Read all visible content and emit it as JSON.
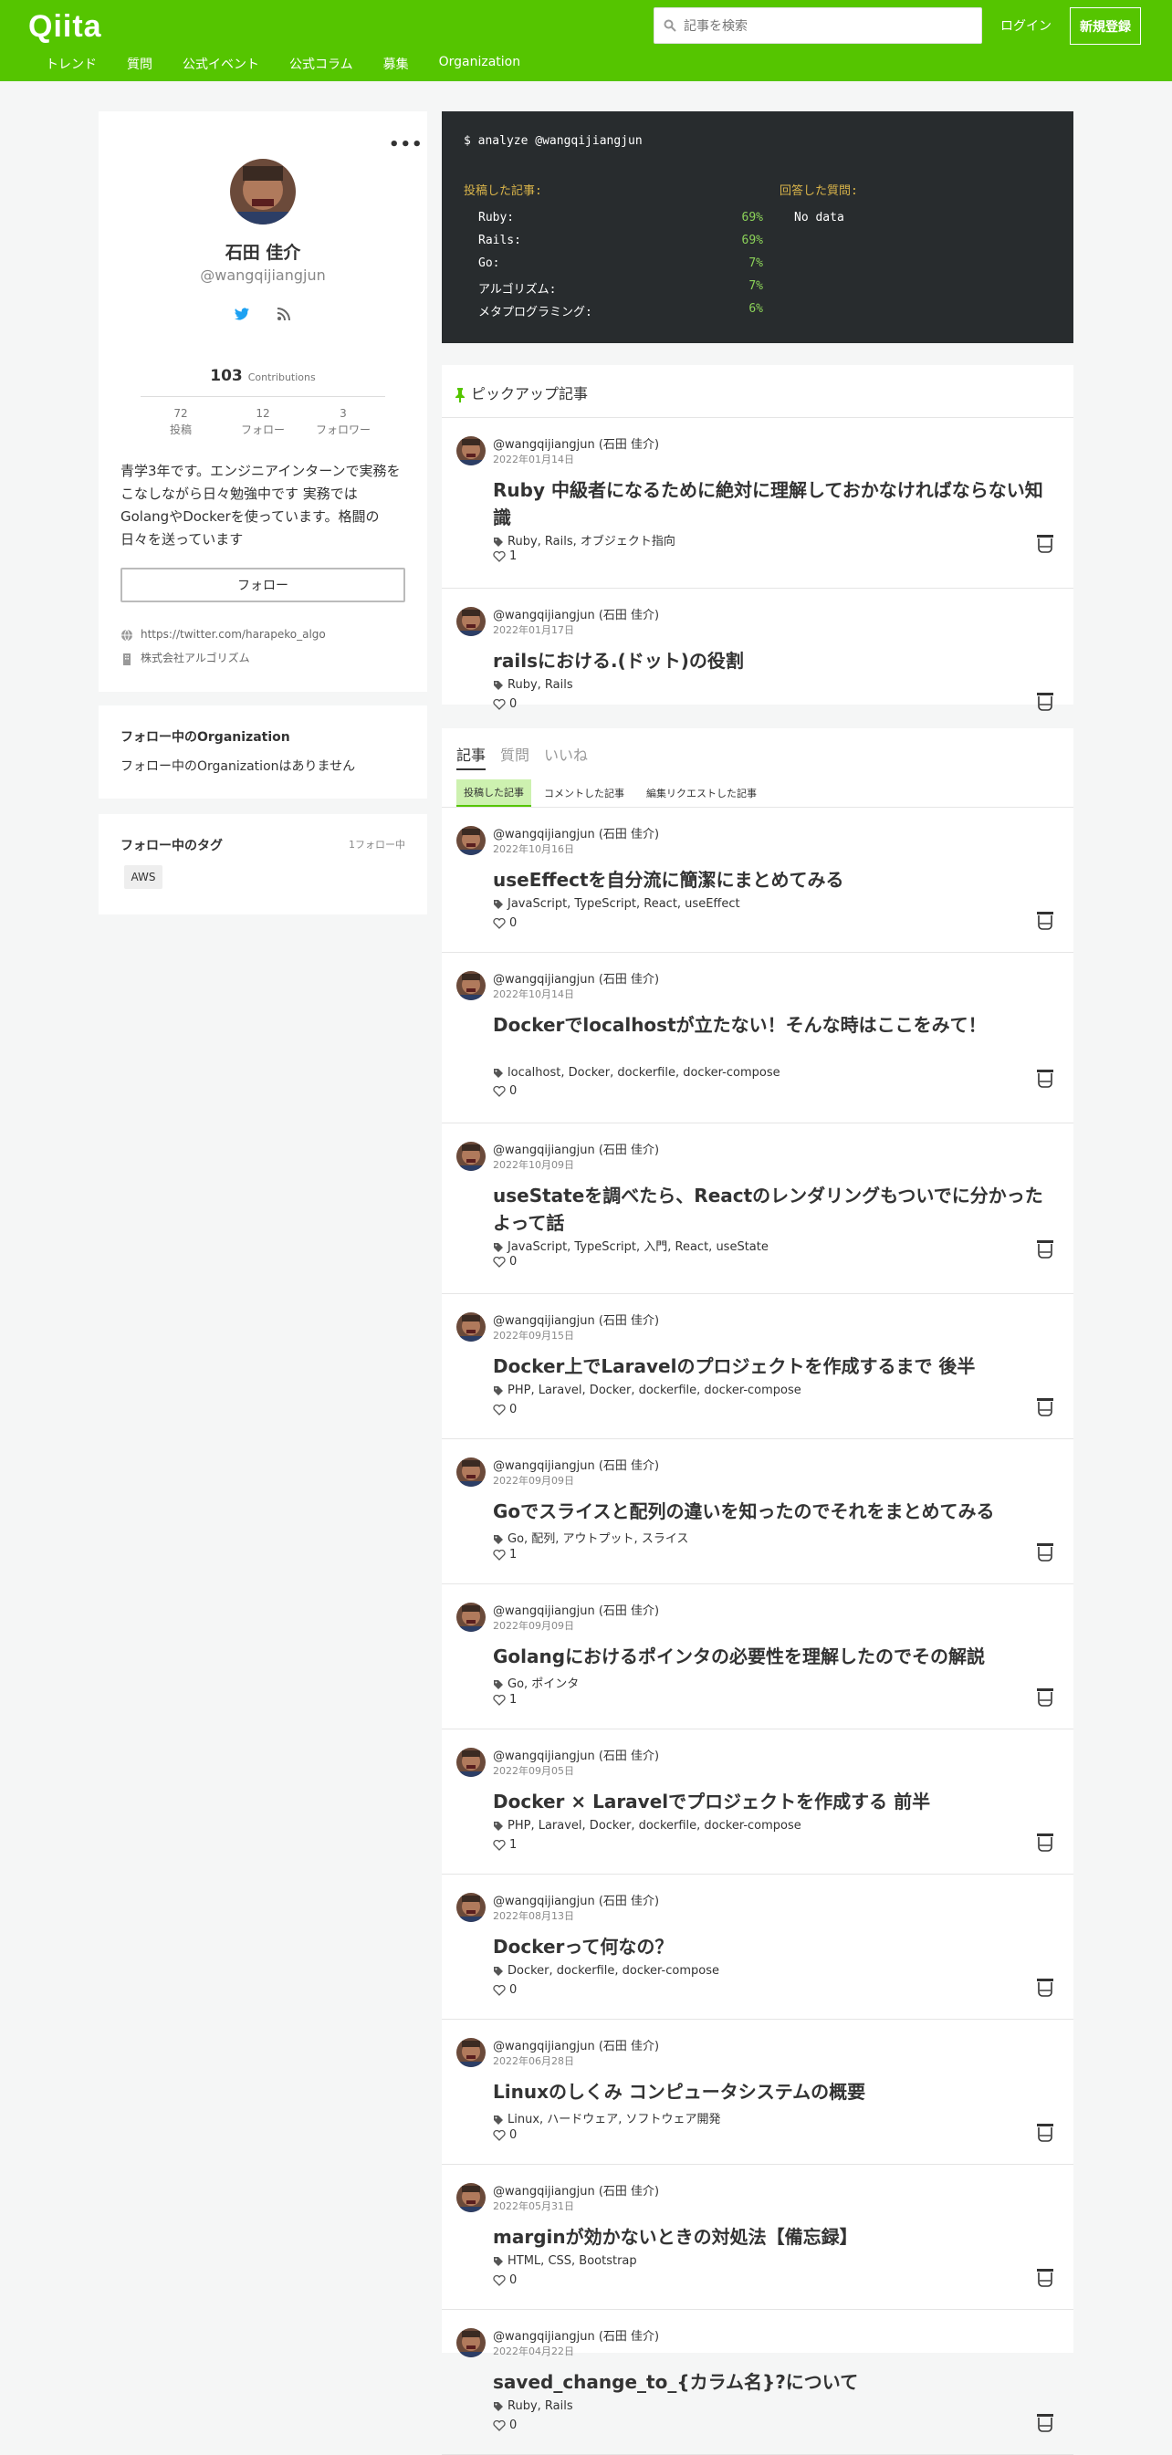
{
  "header": {
    "logo": "Qiita",
    "search_placeholder": "記事を検索",
    "login": "ログイン",
    "signup": "新規登録",
    "nav": [
      "トレンド",
      "質問",
      "公式イベント",
      "公式コラム",
      "募集",
      "Organization"
    ]
  },
  "profile": {
    "more": "•••",
    "name": "石田 佳介",
    "username": "@wangqijiangjun",
    "contributions": "103",
    "contributions_label": "Contributions",
    "stats": [
      {
        "value": "72",
        "label": "投稿"
      },
      {
        "value": "12",
        "label": "フォロー"
      },
      {
        "value": "3",
        "label": "フォロワー"
      }
    ],
    "bio": "青学3年です。エンジニアインターンで実務をこなしながら日々勉強中です 実務ではGolangやDockerを使っています。格闘の日々を送っています",
    "follow_button": "フォロー",
    "website": "https://twitter.com/harapeko_algo",
    "organization": "株式会社アルゴリズム"
  },
  "org_card": {
    "title": "フォロー中のOrganization",
    "empty": "フォロー中のOrganizationはありません"
  },
  "tag_card": {
    "title": "フォロー中のタグ",
    "count": "1フォロー中",
    "tags": [
      "AWS"
    ]
  },
  "analyze": {
    "command": "$ analyze @wangqijiangjun",
    "articles_label": "投稿した記事:",
    "questions_label": "回答した質問:",
    "no_data": "No data",
    "langs": [
      {
        "name": "Ruby:",
        "pct": "69%"
      },
      {
        "name": "Rails:",
        "pct": "69%"
      },
      {
        "name": "Go:",
        "pct": "7%"
      },
      {
        "name": "アルゴリズム:",
        "pct": "7%"
      },
      {
        "name": "メタプログラミング:",
        "pct": "6%"
      }
    ]
  },
  "pickup": {
    "heading": "ピックアップ記事",
    "items": [
      {
        "author": "@wangqijiangjun (石田 佳介)",
        "date": "2022年01月14日",
        "title": "Ruby 中級者になるために絶対に理解しておかなければならない知識",
        "tags": "Ruby, Rails, オブジェクト指向",
        "likes": "1"
      },
      {
        "author": "@wangqijiangjun (石田 佳介)",
        "date": "2022年01月17日",
        "title": "railsにおける.(ドット)の役割",
        "tags": "Ruby, Rails",
        "likes": "0"
      }
    ]
  },
  "articles": {
    "tabs": [
      "記事",
      "質問",
      "いいね"
    ],
    "subtabs": [
      "投稿した記事",
      "コメントした記事",
      "編集リクエストした記事"
    ],
    "items": [
      {
        "author": "@wangqijiangjun (石田 佳介)",
        "date": "2022年10月16日",
        "title": "useEffectを自分流に簡潔にまとめてみる",
        "tags": "JavaScript, TypeScript, React, useEffect",
        "likes": "0"
      },
      {
        "author": "@wangqijiangjun (石田 佳介)",
        "date": "2022年10月14日",
        "title": "Dockerでlocalhostが立たない！そんな時はここをみて！",
        "tags": "localhost, Docker, dockerfile, docker-compose",
        "likes": "0"
      },
      {
        "author": "@wangqijiangjun (石田 佳介)",
        "date": "2022年10月09日",
        "title": "useStateを調べたら、Reactのレンダリングもついでに分かったよって話",
        "tags": "JavaScript, TypeScript, 入門, React, useState",
        "likes": "0"
      },
      {
        "author": "@wangqijiangjun (石田 佳介)",
        "date": "2022年09月15日",
        "title": "Docker上でLaravelのプロジェクトを作成するまで 後半",
        "tags": "PHP, Laravel, Docker, dockerfile, docker-compose",
        "likes": "0"
      },
      {
        "author": "@wangqijiangjun (石田 佳介)",
        "date": "2022年09月09日",
        "title": "Goでスライスと配列の違いを知ったのでそれをまとめてみる",
        "tags": "Go, 配列, アウトプット, スライス",
        "likes": "1"
      },
      {
        "author": "@wangqijiangjun (石田 佳介)",
        "date": "2022年09月09日",
        "title": "Golangにおけるポインタの必要性を理解したのでその解説",
        "tags": "Go, ポインタ",
        "likes": "1"
      },
      {
        "author": "@wangqijiangjun (石田 佳介)",
        "date": "2022年09月05日",
        "title": "Docker × Laravelでプロジェクトを作成する 前半",
        "tags": "PHP, Laravel, Docker, dockerfile, docker-compose",
        "likes": "1"
      },
      {
        "author": "@wangqijiangjun (石田 佳介)",
        "date": "2022年08月13日",
        "title": "Dockerって何なの？",
        "tags": "Docker, dockerfile, docker-compose",
        "likes": "0"
      },
      {
        "author": "@wangqijiangjun (石田 佳介)",
        "date": "2022年06月28日",
        "title": "Linuxのしくみ コンピュータシステムの概要",
        "tags": "Linux, ハードウェア, ソフトウェア開発",
        "likes": "0"
      },
      {
        "author": "@wangqijiangjun (石田 佳介)",
        "date": "2022年05月31日",
        "title": "marginが効かないときの対処法【備忘録】",
        "tags": "HTML, CSS, Bootstrap",
        "likes": "0"
      },
      {
        "author": "@wangqijiangjun (石田 佳介)",
        "date": "2022年04月22日",
        "title": "saved_change_to_{カラム名}?について",
        "tags": "Ruby, Rails",
        "likes": "0"
      }
    ]
  },
  "colors": {
    "brand": "#55c500",
    "terminal_bg": "#282c2e",
    "terminal_label": "#d9b44a",
    "terminal_pct": "#8cd359"
  },
  "icons": [
    "search-icon",
    "twitter-icon",
    "rss-icon",
    "globe-icon",
    "building-icon",
    "pin-icon",
    "tag-icon",
    "heart-icon",
    "stock-icon"
  ]
}
